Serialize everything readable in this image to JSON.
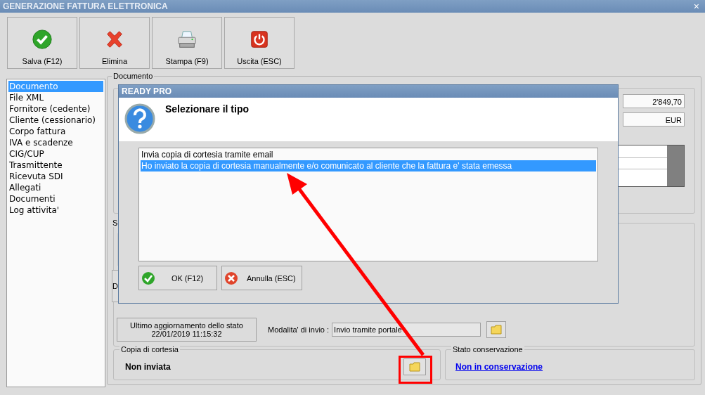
{
  "window": {
    "title": "GENERAZIONE FATTURA ELETTRONICA",
    "close": "×"
  },
  "toolbar": [
    {
      "label": "Salva (F12)",
      "kind": "save"
    },
    {
      "label": "Elimina",
      "kind": "delete"
    },
    {
      "label": "Stampa (F9)",
      "kind": "print"
    },
    {
      "label": "Uscita (ESC)",
      "kind": "exit"
    }
  ],
  "sidebar": {
    "items": [
      {
        "label": "Documento",
        "selected": true
      },
      {
        "label": "File XML",
        "selected": false
      },
      {
        "label": "Fornitore (cedente)",
        "selected": false
      },
      {
        "label": "Cliente (cessionario)",
        "selected": false
      },
      {
        "label": "Corpo fattura",
        "selected": false
      },
      {
        "label": "IVA e scadenze",
        "selected": false
      },
      {
        "label": "CIG/CUP",
        "selected": false
      },
      {
        "label": "Trasmittente",
        "selected": false
      },
      {
        "label": "Ricevuta SDI",
        "selected": false
      },
      {
        "label": "Allegati",
        "selected": false
      },
      {
        "label": "Documenti",
        "selected": false
      },
      {
        "label": "Log attivita'",
        "selected": false
      }
    ]
  },
  "documento": {
    "title": "Documento",
    "total": "2'849,70",
    "currency": "EUR"
  },
  "stato_section": {
    "title": "S",
    "button_1": "D"
  },
  "status": {
    "last_update_label": "Ultimo aggiornamento dello stato",
    "last_update": "22/01/2019 11:15:32",
    "mode_label": "Modalita' di invio :",
    "mode_value": "Invio tramite portale"
  },
  "copia_cortesia": {
    "title": "Copia di cortesia",
    "value": "Non inviata"
  },
  "stato_conservazione": {
    "title": "Stato conservazione",
    "link": "Non in conservazione"
  },
  "dialog": {
    "title": "READY PRO",
    "heading": "Selezionare il tipo",
    "options": [
      {
        "label": "Invia copia di cortesia tramite email",
        "selected": false
      },
      {
        "label": "Ho inviato la copia di cortesia manualmente e/o comunicato al cliente che la fattura e' stata emessa",
        "selected": true
      }
    ],
    "buttons": [
      {
        "label": "OK (F12)",
        "kind": "ok"
      },
      {
        "label": "Annulla (ESC)",
        "kind": "cancel"
      }
    ]
  }
}
